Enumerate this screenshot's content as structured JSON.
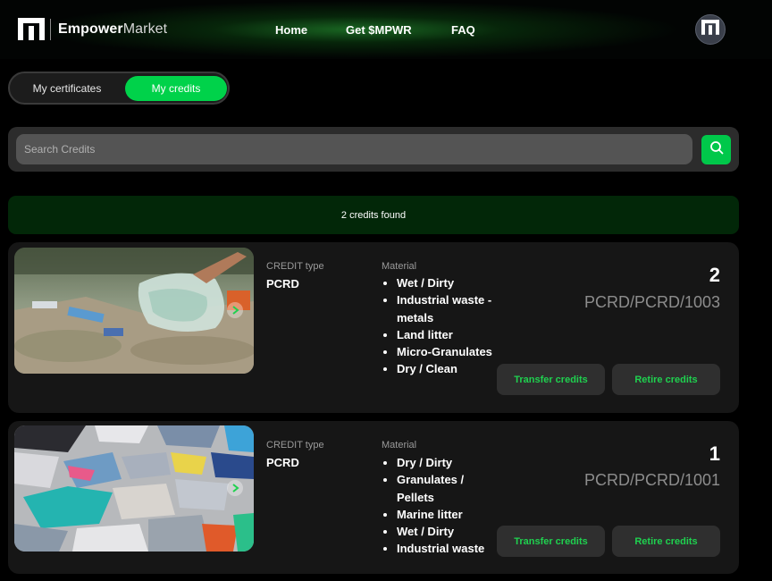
{
  "header": {
    "brand_bold": "Empower",
    "brand_light": "Market",
    "nav": {
      "home": "Home",
      "get_prefix": "Get ",
      "get_token": "$MPWR",
      "faq": "FAQ"
    }
  },
  "tabs": {
    "certificates": "My certificates",
    "credits": "My credits",
    "active": "credits"
  },
  "search": {
    "placeholder": "Search Credits",
    "value": ""
  },
  "results": {
    "summary": "2 credits found"
  },
  "credits": [
    {
      "credit_type_label": "CREDIT type",
      "credit_type": "PCRD",
      "material_label": "Material",
      "materials": [
        "Wet / Dirty",
        "Industrial waste - metals",
        "Land litter",
        "Micro-Granulates",
        "Dry / Clean"
      ],
      "amount": "2",
      "id": "PCRD/PCRD/1003",
      "transfer_label": "Transfer credits",
      "retire_label": "Retire credits"
    },
    {
      "credit_type_label": "CREDIT type",
      "credit_type": "PCRD",
      "material_label": "Material",
      "materials": [
        "Dry / Dirty",
        "Granulates / Pellets",
        "Marine litter",
        "Wet / Dirty",
        "Industrial waste"
      ],
      "amount": "1",
      "id": "PCRD/PCRD/1001",
      "transfer_label": "Transfer credits",
      "retire_label": "Retire credits"
    }
  ],
  "colors": {
    "accent": "#00d24a",
    "card_bg": "#161616",
    "banner_bg": "#022708"
  },
  "icons": [
    "empower-logo-icon",
    "avatar-logo-icon",
    "search-icon",
    "carousel-arrow-icon"
  ]
}
